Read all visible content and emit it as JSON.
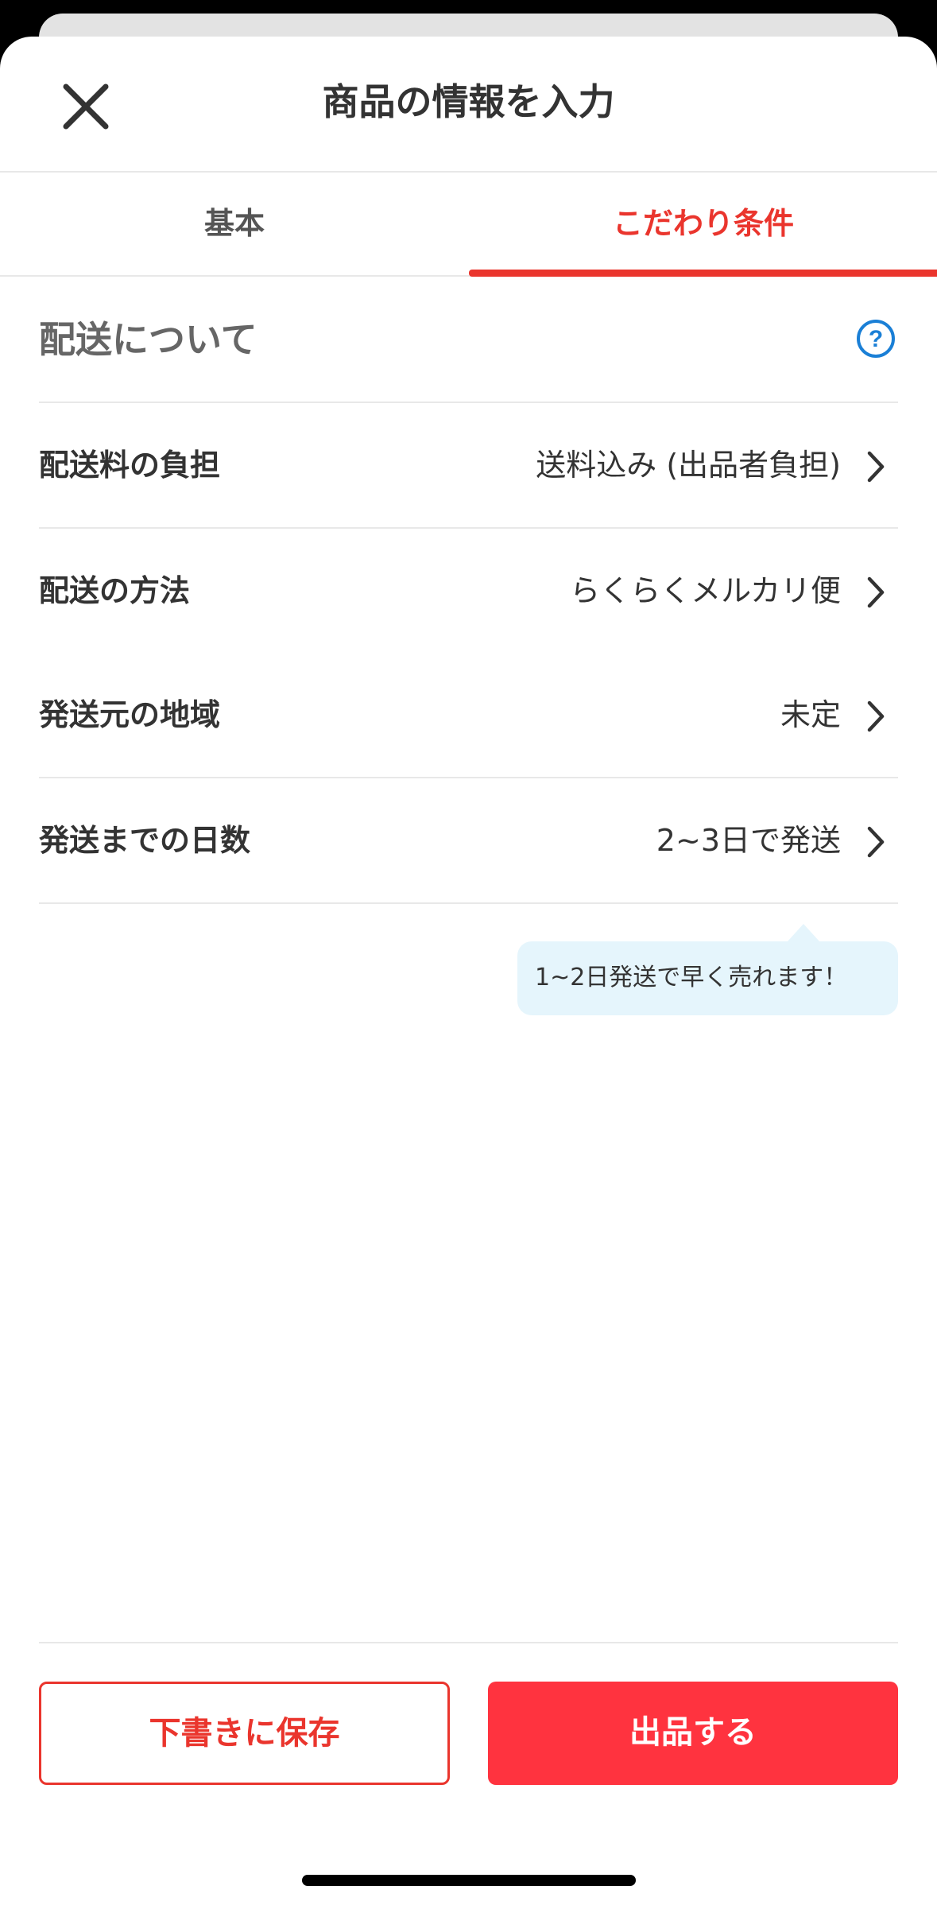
{
  "header": {
    "title": "商品の情報を入力"
  },
  "tabs": [
    {
      "label": "基本",
      "active": false
    },
    {
      "label": "こだわり条件",
      "active": true
    }
  ],
  "section": {
    "title": "配送について",
    "help_icon": "question-circle-icon"
  },
  "rows": [
    {
      "label": "配送料の負担",
      "value": "送料込み (出品者負担)"
    },
    {
      "label": "配送の方法",
      "value": "らくらくメルカリ便"
    },
    {
      "label": "発送元の地域",
      "value": "未定"
    },
    {
      "label": "発送までの日数",
      "value": "2~3日で発送"
    }
  ],
  "tooltip": {
    "text": "1~2日発送で早く売れます！"
  },
  "footer": {
    "draft_label": "下書きに保存",
    "list_label": "出品する"
  },
  "colors": {
    "accent": "#ea352d",
    "primary_button": "#ff333f",
    "help_icon": "#1a7fd6",
    "tooltip_bg": "#e5f5fc",
    "text": "#333333",
    "divider": "#e8e8e8"
  }
}
